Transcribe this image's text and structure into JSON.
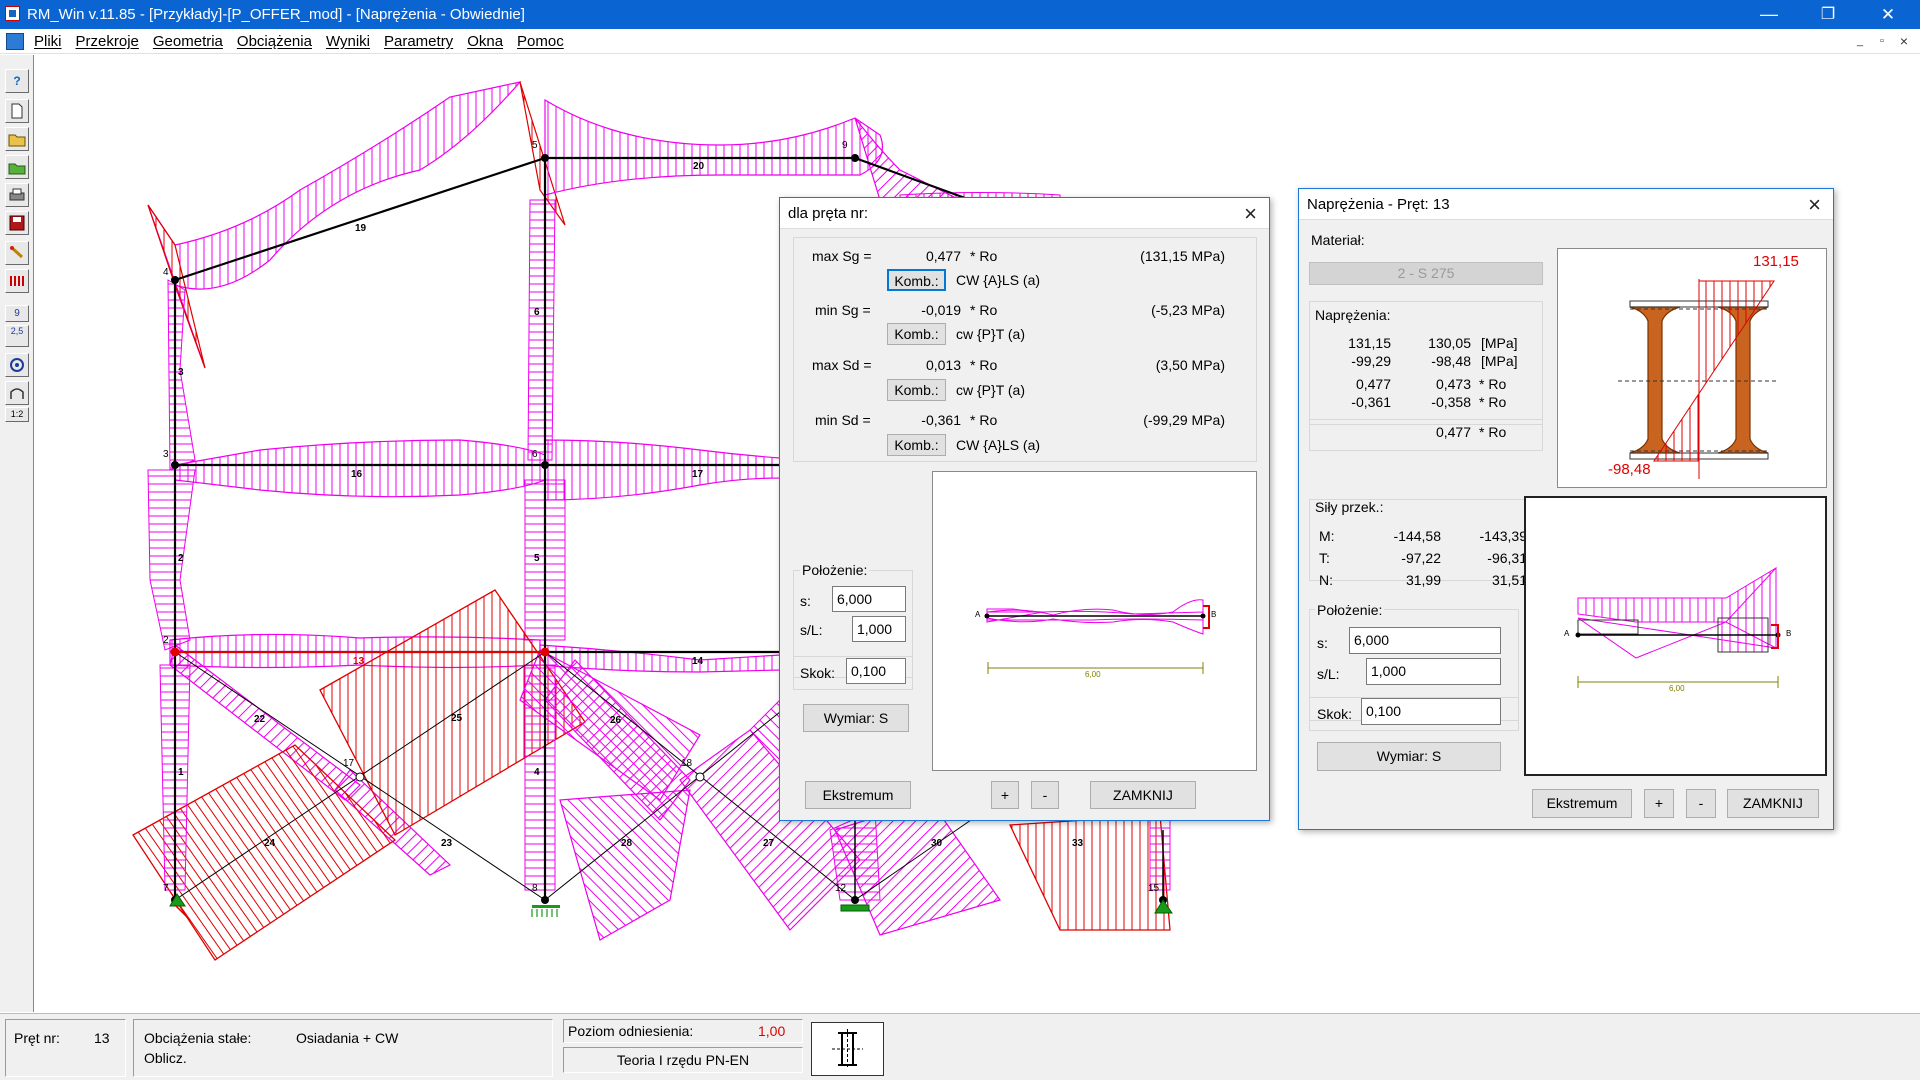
{
  "window": {
    "title": "RM_Win v.11.85 - [Przykłady]-[P_OFFER_mod] - [Naprężenia - Obwiednie]",
    "minimize": "—",
    "restore": "❐",
    "close": "✕"
  },
  "menu": {
    "items": [
      "Pliki",
      "Przekroje",
      "Geometria",
      "Obciążenia",
      "Wyniki",
      "Parametry",
      "Okna",
      "Pomoc"
    ],
    "mdi_minimize": "_",
    "mdi_restore": "▫",
    "mdi_close": "×"
  },
  "toolbar": {
    "help": "?",
    "node_num": "9",
    "dim": "2,5",
    "scale": "1:2"
  },
  "canvas": {
    "member_labels": [
      "19",
      "20",
      "3",
      "6",
      "16",
      "17",
      "2",
      "5",
      "13",
      "14",
      "22",
      "25",
      "26",
      "1",
      "4",
      "24",
      "23",
      "28",
      "27",
      "30",
      "33"
    ],
    "node_labels": [
      "4",
      "5",
      "9",
      "3",
      "6",
      "2",
      "17",
      "18",
      "7",
      "8",
      "12",
      "15"
    ]
  },
  "dlg1": {
    "title": "dla pręta nr:",
    "rows": [
      {
        "label": "max Sg =",
        "value": "0,477",
        "unit": "* Ro",
        "mpa": "(131,15 MPa)",
        "komb": "Komb.:",
        "comb": "CW {A}LS (a)"
      },
      {
        "label": "min Sg =",
        "value": "-0,019",
        "unit": "* Ro",
        "mpa": "(-5,23 MPa)",
        "komb": "Komb.:",
        "comb": "cw {P}T (a)"
      },
      {
        "label": "max Sd =",
        "value": "0,013",
        "unit": "* Ro",
        "mpa": "(3,50 MPa)",
        "komb": "Komb.:",
        "comb": "cw {P}T (a)"
      },
      {
        "label": "min Sd =",
        "value": "-0,361",
        "unit": "* Ro",
        "mpa": "(-99,29 MPa)",
        "komb": "Komb.:",
        "comb": "CW {A}LS (a)"
      }
    ],
    "polozenie": "Położenie:",
    "s_label": "s:",
    "s_value": "6,000",
    "sl_label": "s/L:",
    "sl_value": "1,000",
    "skok_label": "Skok:",
    "skok_value": "0,100",
    "wymiar": "Wymiar: S",
    "ekstremum": "Ekstremum",
    "plus": "+",
    "minus": "-",
    "zamknij": "ZAMKNIJ",
    "plot_a": "A",
    "plot_b": "B",
    "plot_len": "6,00"
  },
  "dlg2": {
    "title": "Naprężenia - Pręt: 13",
    "material_label": "Materiał:",
    "material_value": "2 - S 275",
    "napr_label": "Naprężenia:",
    "napr_rows": [
      [
        "131,15",
        "130,05",
        "[MPa]"
      ],
      [
        "-99,29",
        "-98,48",
        "[MPa]"
      ],
      [
        "0,477",
        "0,473",
        "* Ro"
      ],
      [
        "-0,361",
        "-0,358",
        "* Ro"
      ]
    ],
    "napr_total": [
      "0,477",
      "* Ro"
    ],
    "section_top": "131,15",
    "section_bottom": "-98,48",
    "sily_label": "Siły przek.:",
    "sily_rows": [
      [
        "M:",
        "-144,58",
        "-143,39"
      ],
      [
        "T:",
        "-97,22",
        "-96,31"
      ],
      [
        "N:",
        "31,99",
        "31,51"
      ]
    ],
    "polozenie": "Położenie:",
    "s_label": "s:",
    "s_value": "6,000",
    "sl_label": "s/L:",
    "sl_value": "1,000",
    "skok_label": "Skok:",
    "skok_value": "0,100",
    "wymiar": "Wymiar: S",
    "ekstremum": "Ekstremum",
    "plus": "+",
    "minus": "-",
    "zamknij": "ZAMKNIJ",
    "plot_a": "A",
    "plot_b": "B",
    "plot_len": "6,00"
  },
  "status": {
    "pret_label": "Pręt nr:",
    "pret_value": "13",
    "obc_label": "Obciążenia stałe:",
    "obc_value": "Osiadania + CW",
    "oblicz": "Oblicz.",
    "poziom_label": "Poziom odniesienia:",
    "poziom_value": "1,00",
    "teoria": "Teoria I rzędu PN-EN"
  },
  "colors": {
    "titlebar": "#0a64d2",
    "magenta": "#ee00ee",
    "red": "#e00000",
    "accent": "#1c77d6"
  }
}
